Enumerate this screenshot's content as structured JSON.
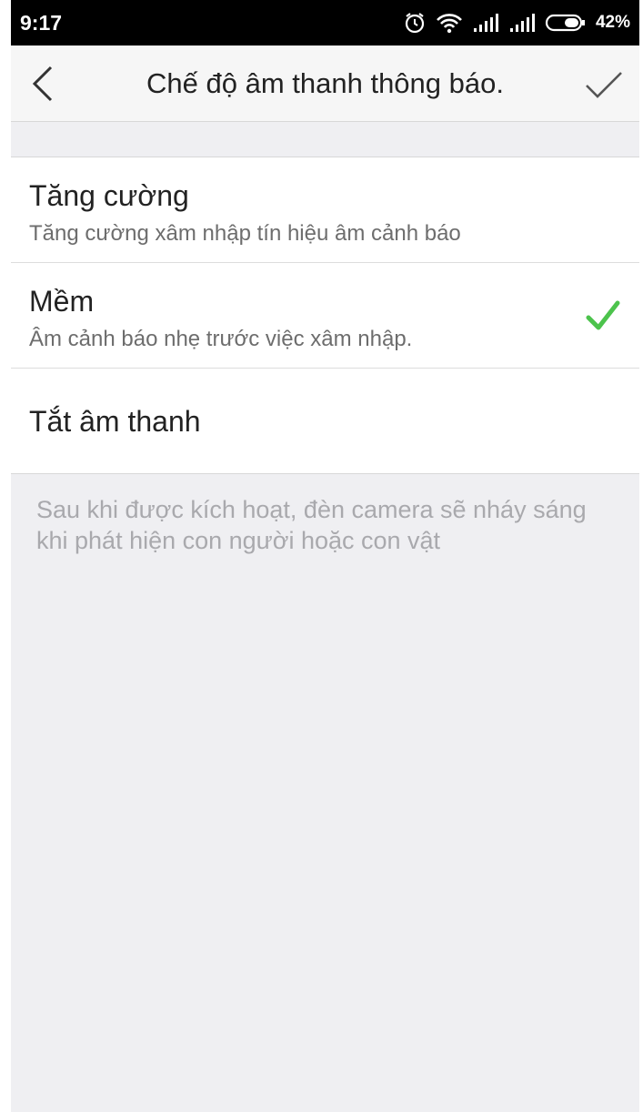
{
  "status_bar": {
    "time": "9:17",
    "battery_percent": "42%",
    "icons": [
      "alarm-icon",
      "wifi-icon",
      "signal-icon",
      "signal-icon",
      "battery-icon"
    ]
  },
  "header": {
    "title": "Chế độ âm thanh thông báo.",
    "back_icon": "chevron-left-icon",
    "confirm_icon": "checkmark-icon"
  },
  "options": [
    {
      "title": "Tăng cường",
      "subtitle": "Tăng cường xâm nhập tín hiệu âm cảnh báo",
      "selected": false
    },
    {
      "title": "Mềm",
      "subtitle": "Âm cảnh báo nhẹ trước việc xâm nhập.",
      "selected": true
    },
    {
      "title": "Tắt âm thanh",
      "selected": false
    }
  ],
  "note": "Sau khi được kích hoạt, đèn camera sẽ nháy sáng khi phát hiện con người hoặc con vật",
  "colors": {
    "accent_check": "#4cc34c",
    "background": "#efeff2",
    "status_bar": "#000000"
  }
}
